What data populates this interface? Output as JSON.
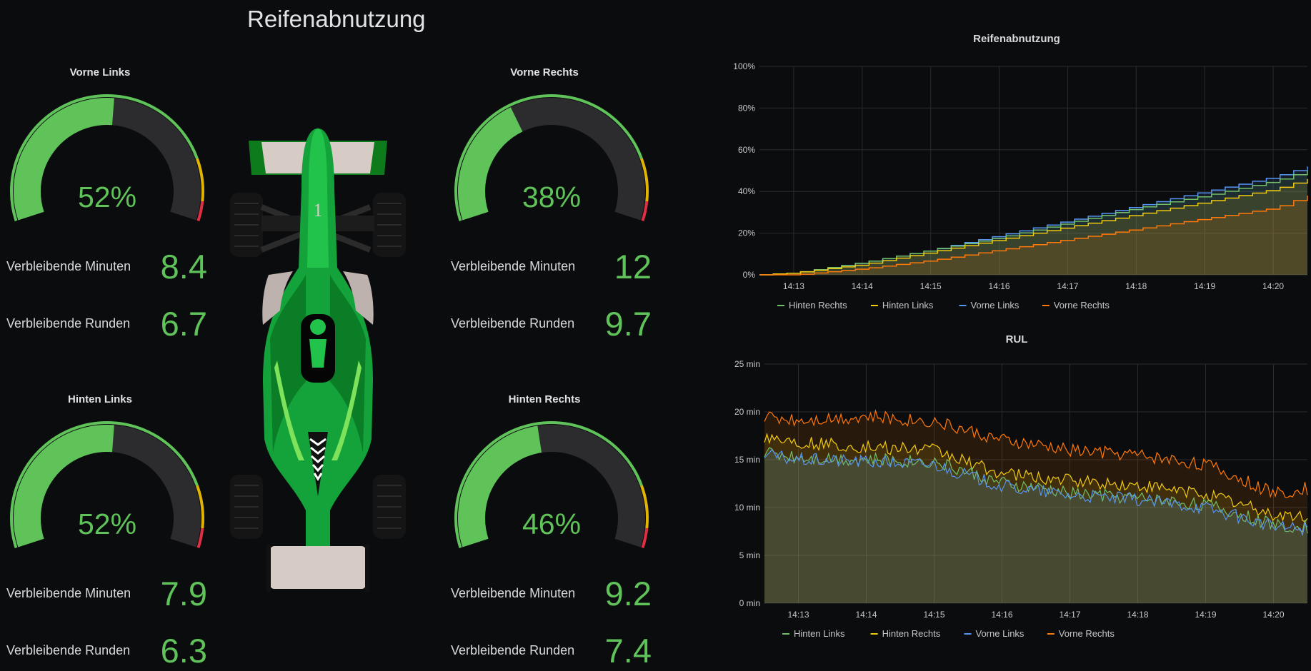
{
  "dashboard": {
    "title": "Reifenabnutzung",
    "gauges": [
      {
        "id": "vl",
        "title": "Vorne Links",
        "percent": 52,
        "percent_text": "52%",
        "minutes_label": "Verbleibende Minuten",
        "minutes": "8.4",
        "laps_label": "Verbleibende Runden",
        "laps": "6.7"
      },
      {
        "id": "vr",
        "title": "Vorne Rechts",
        "percent": 38,
        "percent_text": "38%",
        "minutes_label": "Verbleibende Minuten",
        "minutes": "12",
        "laps_label": "Verbleibende Runden",
        "laps": "9.7"
      },
      {
        "id": "hl",
        "title": "Hinten Links",
        "percent": 52,
        "percent_text": "52%",
        "minutes_label": "Verbleibende Minuten",
        "minutes": "7.9",
        "laps_label": "Verbleibende Runden",
        "laps": "6.3"
      },
      {
        "id": "hr",
        "title": "Hinten Rechts",
        "percent": 46,
        "percent_text": "46%",
        "minutes_label": "Verbleibende Minuten",
        "minutes": "9.2",
        "laps_label": "Verbleibende Runden",
        "laps": "7.4"
      }
    ],
    "gauge_colors": {
      "filled": "#5fc35a",
      "empty": "#2c2c2e",
      "threshold_green": "#5fc35a",
      "threshold_yellow": "#e0b400",
      "threshold_red": "#e02f44"
    }
  },
  "chart_data": [
    {
      "type": "line",
      "title": "Reifenabnutzung",
      "x": [
        "14:12:30",
        "14:13",
        "14:14",
        "14:15",
        "14:16",
        "14:17",
        "14:18",
        "14:19",
        "14:20",
        "14:20:30"
      ],
      "x_ticks": [
        "14:13",
        "14:14",
        "14:15",
        "14:16",
        "14:17",
        "14:18",
        "14:19",
        "14:20"
      ],
      "y_ticks": [
        "0%",
        "20%",
        "40%",
        "60%",
        "80%",
        "100%"
      ],
      "ylim": [
        0,
        100
      ],
      "grid": true,
      "legend_position": "bottom-left",
      "series": [
        {
          "name": "Hinten Rechts",
          "color": "#73bf69",
          "values": [
            0,
            1,
            6,
            12,
            18,
            25,
            32,
            38,
            45,
            50
          ]
        },
        {
          "name": "Hinten Links",
          "color": "#f2cc0c",
          "values": [
            0,
            1,
            5,
            11,
            17,
            23,
            29,
            35,
            41,
            46
          ]
        },
        {
          "name": "Vorne Links",
          "color": "#5794f2",
          "values": [
            0,
            1,
            6,
            12,
            19,
            26,
            33,
            40,
            47,
            52
          ]
        },
        {
          "name": "Vorne Rechts",
          "color": "#ff780a",
          "values": [
            0,
            0,
            3,
            7,
            12,
            17,
            22,
            27,
            32,
            38
          ]
        }
      ]
    },
    {
      "type": "line",
      "title": "RUL",
      "x": [
        "14:12:30",
        "14:13",
        "14:14",
        "14:15",
        "14:16",
        "14:17",
        "14:18",
        "14:19",
        "14:20",
        "14:20:30"
      ],
      "x_ticks": [
        "14:13",
        "14:14",
        "14:15",
        "14:16",
        "14:17",
        "14:18",
        "14:19",
        "14:20"
      ],
      "y_ticks": [
        "0 min",
        "5 min",
        "10 min",
        "15 min",
        "20 min",
        "25 min"
      ],
      "ylim": [
        0,
        25
      ],
      "grid": true,
      "legend_position": "bottom-left",
      "series": [
        {
          "name": "Hinten Links",
          "color": "#73bf69",
          "values": [
            15.8,
            15.3,
            15.0,
            14.8,
            12.5,
            11.5,
            11.0,
            10.3,
            8.2,
            8.0
          ]
        },
        {
          "name": "Hinten Rechts",
          "color": "#f2cc0c",
          "values": [
            17.5,
            16.8,
            16.3,
            16.0,
            13.5,
            12.8,
            12.2,
            11.5,
            9.3,
            9.0
          ]
        },
        {
          "name": "Vorne Links",
          "color": "#5794f2",
          "values": [
            15.5,
            15.0,
            14.8,
            14.5,
            12.2,
            11.3,
            10.8,
            10.0,
            8.0,
            7.8
          ]
        },
        {
          "name": "Vorne Rechts",
          "color": "#ff780a",
          "values": [
            19.5,
            19.2,
            19.5,
            19.0,
            17.0,
            16.0,
            15.5,
            14.5,
            11.5,
            12.0
          ]
        }
      ]
    }
  ]
}
